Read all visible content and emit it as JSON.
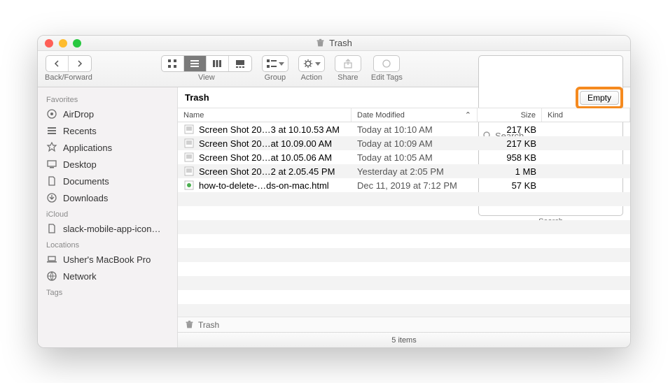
{
  "window": {
    "title": "Trash"
  },
  "toolbar": {
    "nav_label": "Back/Forward",
    "view_label": "View",
    "group_label": "Group",
    "action_label": "Action",
    "share_label": "Share",
    "tags_label": "Edit Tags",
    "search_label": "Search",
    "search_placeholder": "Search"
  },
  "header": {
    "title": "Trash",
    "empty_label": "Empty"
  },
  "columns": {
    "name": "Name",
    "date_modified": "Date Modified",
    "size": "Size",
    "kind": "Kind"
  },
  "sidebar": {
    "sections": [
      {
        "label": "Favorites",
        "items": [
          {
            "name": "AirDrop",
            "icon": "airdrop"
          },
          {
            "name": "Recents",
            "icon": "recents"
          },
          {
            "name": "Applications",
            "icon": "apps"
          },
          {
            "name": "Desktop",
            "icon": "desktop"
          },
          {
            "name": "Documents",
            "icon": "documents"
          },
          {
            "name": "Downloads",
            "icon": "downloads"
          }
        ]
      },
      {
        "label": "iCloud",
        "items": [
          {
            "name": "slack-mobile-app-icon…",
            "icon": "file"
          }
        ]
      },
      {
        "label": "Locations",
        "items": [
          {
            "name": "Usher's MacBook Pro",
            "icon": "laptop"
          },
          {
            "name": "Network",
            "icon": "network"
          }
        ]
      },
      {
        "label": "Tags",
        "items": []
      }
    ]
  },
  "files": [
    {
      "name": "Screen Shot 20…3 at 10.10.53 AM",
      "date": "Today at 10:10 AM",
      "size": "217 KB",
      "icon": "img"
    },
    {
      "name": "Screen Shot 20…at 10.09.00 AM",
      "date": "Today at 10:09 AM",
      "size": "217 KB",
      "icon": "img"
    },
    {
      "name": "Screen Shot 20…at 10.05.06 AM",
      "date": "Today at 10:05 AM",
      "size": "958 KB",
      "icon": "img"
    },
    {
      "name": "Screen Shot 20…2 at 2.05.45 PM",
      "date": "Yesterday at 2:05 PM",
      "size": "1 MB",
      "icon": "img"
    },
    {
      "name": "how-to-delete-…ds-on-mac.html",
      "date": "Dec 11, 2019 at 7:12 PM",
      "size": "57 KB",
      "icon": "html"
    }
  ],
  "pathbar": {
    "location": "Trash"
  },
  "status": {
    "text": "5 items"
  }
}
